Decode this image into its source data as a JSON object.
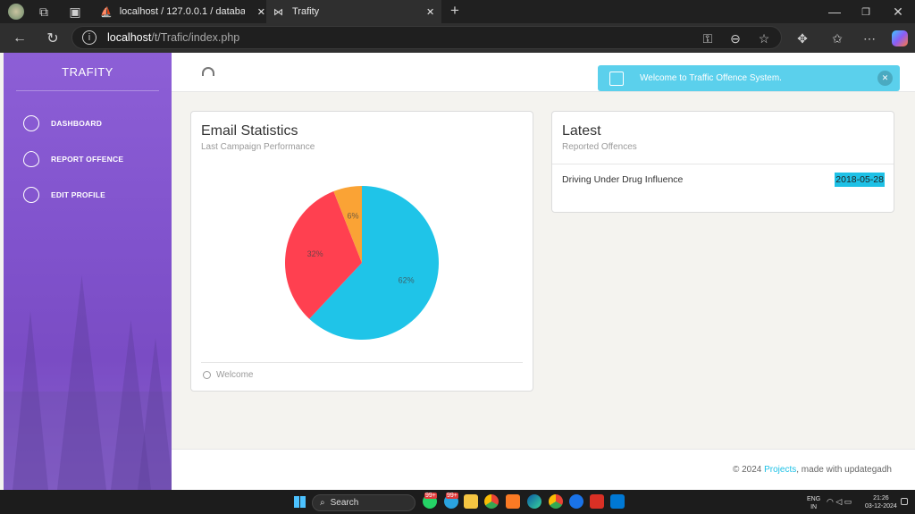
{
  "browser": {
    "tabs": [
      {
        "title": "localhost / 127.0.0.1 / database / "
      },
      {
        "title": "Trafity"
      }
    ],
    "url_host": "localhost",
    "url_path": "/t/Trafic/index.php"
  },
  "sidebar": {
    "brand": "TRAFITY",
    "items": [
      {
        "label": "DASHBOARD",
        "icon": "pie-chart-icon"
      },
      {
        "label": "REPORT OFFENCE",
        "icon": "eye-icon"
      },
      {
        "label": "EDIT PROFILE",
        "icon": "user-icon"
      }
    ]
  },
  "alert": {
    "text": "Welcome to Traffic Offence System.",
    "color": "#5bd0ec"
  },
  "email_card": {
    "title": "Email Statistics",
    "subtitle": "Last Campaign Performance",
    "footer": "Welcome"
  },
  "latest_card": {
    "title": "Latest",
    "subtitle": "Reported Offences",
    "rows": [
      {
        "offence": "Driving Under Drug Influence",
        "date": "2018-05-28"
      }
    ]
  },
  "footer": {
    "prefix": "© 2024 ",
    "link": "Projects",
    "suffix": ", made with updategadh"
  },
  "taskbar": {
    "search": "Search",
    "lang": "ENG",
    "region": "IN",
    "time": "21:26",
    "date": "03-12-2024",
    "badge": "99+"
  },
  "chart_data": {
    "type": "pie",
    "categories": [
      "62%",
      "32%",
      "6%"
    ],
    "values": [
      62,
      32,
      6
    ],
    "colors": [
      "#1fc4e8",
      "#ff4050",
      "#faa335"
    ]
  }
}
